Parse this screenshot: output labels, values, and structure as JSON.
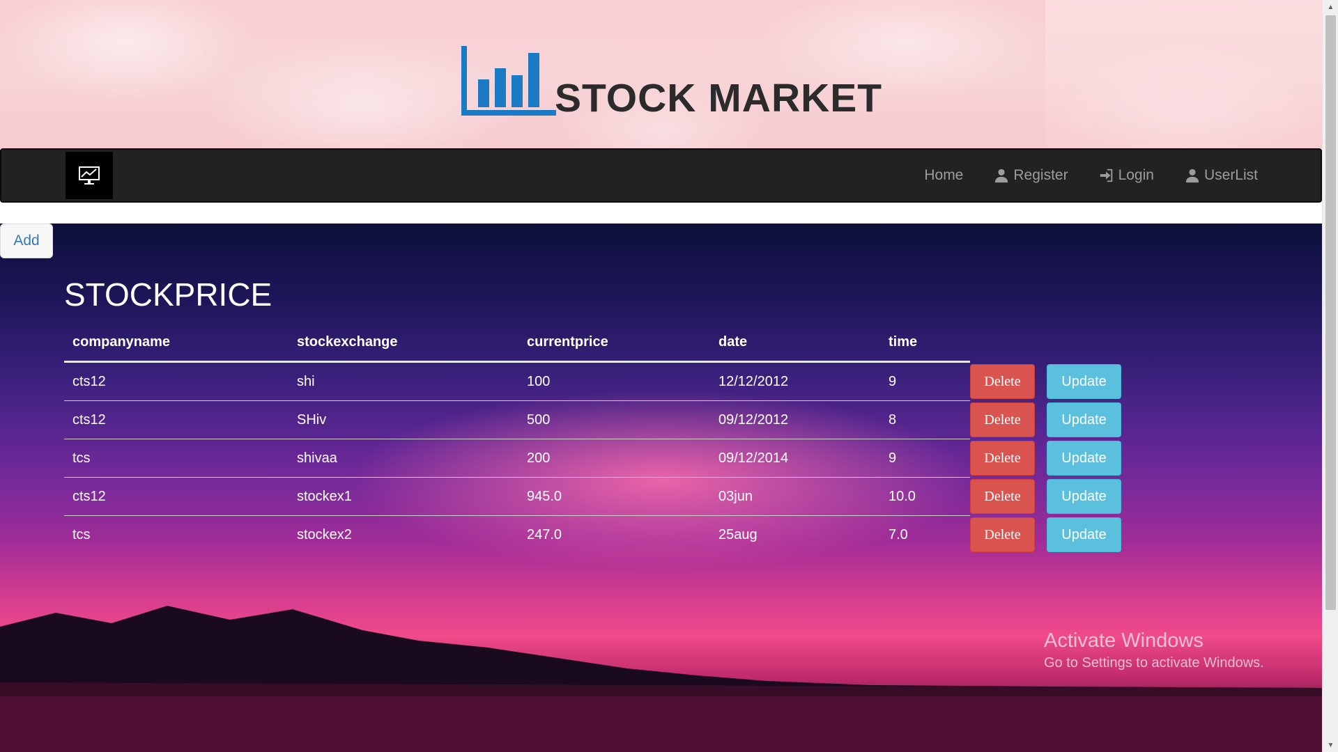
{
  "header": {
    "title": "STOCK MARKET",
    "logo_icon": "bar-chart-icon"
  },
  "navbar": {
    "logo_icon": "monitor-chart-icon",
    "links": [
      {
        "label": "Home",
        "icon": ""
      },
      {
        "label": "Register",
        "icon": "user-icon"
      },
      {
        "label": "Login",
        "icon": "login-icon"
      },
      {
        "label": "UserList",
        "icon": "user-icon"
      }
    ]
  },
  "add_button": {
    "label": "Add"
  },
  "section": {
    "title": "STOCKPRICE"
  },
  "table": {
    "columns": [
      "companyname",
      "stockexchange",
      "currentprice",
      "date",
      "time"
    ],
    "rows": [
      {
        "companyname": "cts12",
        "stockexchange": "shi",
        "currentprice": "100",
        "date": "12/12/2012",
        "time": "9"
      },
      {
        "companyname": "cts12",
        "stockexchange": "SHiv",
        "currentprice": "500",
        "date": "09/12/2012",
        "time": "8"
      },
      {
        "companyname": "tcs",
        "stockexchange": "shivaa",
        "currentprice": "200",
        "date": "09/12/2014",
        "time": "9"
      },
      {
        "companyname": "cts12",
        "stockexchange": "stockex1",
        "currentprice": "945.0",
        "date": "03jun",
        "time": "10.0"
      },
      {
        "companyname": "tcs",
        "stockexchange": "stockex2",
        "currentprice": "247.0",
        "date": "25aug",
        "time": "7.0"
      }
    ],
    "delete_label": "Delete",
    "update_label": "Update"
  },
  "watermark": {
    "title": "Activate Windows",
    "subtitle": "Go to Settings to activate Windows."
  },
  "colors": {
    "brand_blue": "#1a7bc4",
    "navbar_bg": "#222222",
    "delete_red": "#d9534f",
    "update_cyan": "#5bc0de",
    "add_text_blue": "#337ab7"
  }
}
